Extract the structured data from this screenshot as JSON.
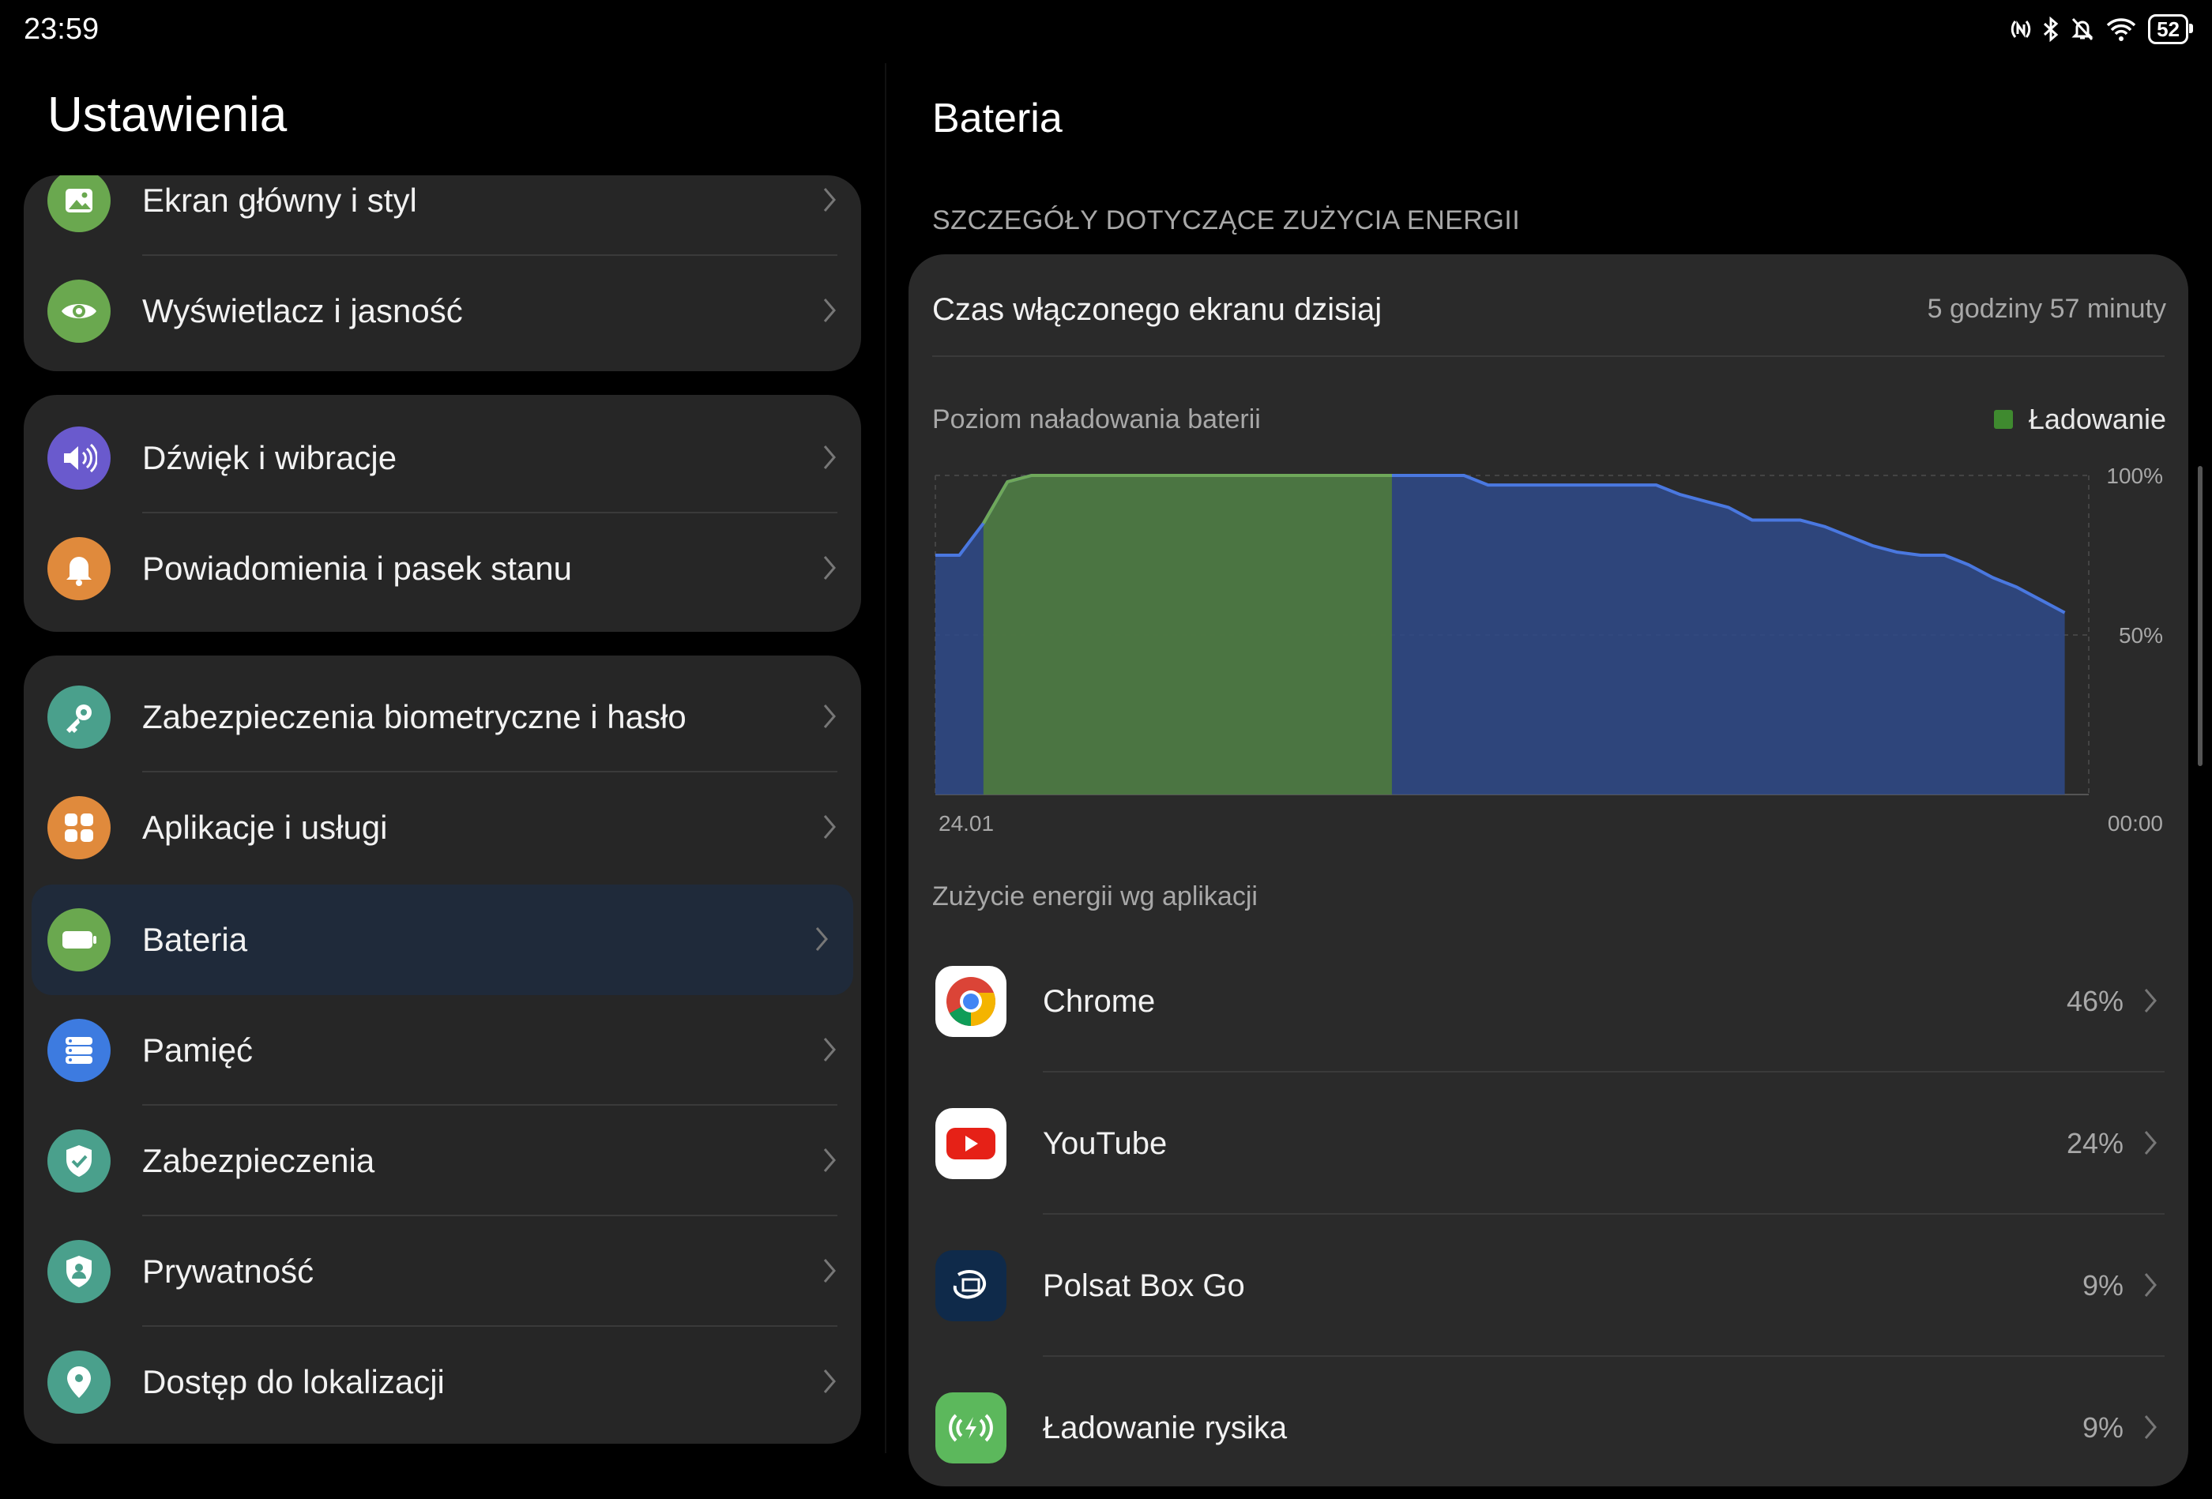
{
  "status_bar": {
    "time": "23:59",
    "battery": "52",
    "icons": [
      "nfc-icon",
      "bluetooth-icon",
      "mute-icon",
      "wifi-icon",
      "battery-icon"
    ]
  },
  "left": {
    "title": "Ustawienia",
    "groups": [
      {
        "items": [
          {
            "label": "Ekran główny i styl",
            "icon": "wallpaper-icon",
            "color": "#6aa84f"
          },
          {
            "label": "Wyświetlacz i jasność",
            "icon": "eye-icon",
            "color": "#6aa84f"
          }
        ]
      },
      {
        "items": [
          {
            "label": "Dźwięk i wibracje",
            "icon": "speaker-icon",
            "color": "#6a5acd"
          },
          {
            "label": "Powiadomienia i pasek stanu",
            "icon": "bell-icon",
            "color": "#e08a3c"
          }
        ]
      },
      {
        "items": [
          {
            "label": "Zabezpieczenia biometryczne i hasło",
            "icon": "key-icon",
            "color": "#4aa08c"
          },
          {
            "label": "Aplikacje i usługi",
            "icon": "apps-icon",
            "color": "#e08a3c"
          },
          {
            "label": "Bateria",
            "icon": "battery-icon",
            "color": "#6aa84f",
            "selected": true
          },
          {
            "label": "Pamięć",
            "icon": "storage-icon",
            "color": "#3d7be0"
          },
          {
            "label": "Zabezpieczenia",
            "icon": "shield-check-icon",
            "color": "#4aa08c"
          },
          {
            "label": "Prywatność",
            "icon": "privacy-icon",
            "color": "#4aa08c"
          },
          {
            "label": "Dostęp do lokalizacji",
            "icon": "location-icon",
            "color": "#4aa08c"
          }
        ]
      }
    ]
  },
  "right": {
    "title": "Bateria",
    "section_caption": "SZCZEGÓŁY DOTYCZĄCE ZUŻYCIA ENERGII",
    "screen_time_label": "Czas włączonego ekranu dzisiaj",
    "screen_time_value": "5 godziny 57 minuty",
    "chart_label": "Poziom naładowania baterii",
    "legend_label": "Ładowanie",
    "apps_caption": "Zużycie energii wg aplikacji",
    "apps": [
      {
        "name": "Chrome",
        "percent": "46%",
        "icon": "chrome-icon"
      },
      {
        "name": "YouTube",
        "percent": "24%",
        "icon": "youtube-icon"
      },
      {
        "name": "Polsat Box Go",
        "percent": "9%",
        "icon": "polsat-box-go-icon"
      },
      {
        "name": "Ładowanie rysika",
        "percent": "9%",
        "icon": "stylus-charging-icon"
      }
    ]
  },
  "chart_data": {
    "type": "area",
    "title": "Poziom naładowania baterii",
    "x_tick_labels": [
      "24.01",
      "00:00"
    ],
    "y_tick_labels": [
      "100%",
      "50%"
    ],
    "ylim": [
      0,
      100
    ],
    "xlim": [
      0,
      24
    ],
    "x_unit": "hours since 24.01 00:00",
    "legend": [
      "Ładowanie"
    ],
    "grid": true,
    "colors": {
      "line": "#4a78e0",
      "fill": "#2f4a8a",
      "charging": "#4f7a3c",
      "charging_line": "#6fa85a"
    },
    "charging_ranges": [
      [
        1.0,
        9.5
      ]
    ],
    "series": [
      {
        "name": "Bateria",
        "points": [
          [
            0.0,
            75
          ],
          [
            0.5,
            75
          ],
          [
            1.0,
            85
          ],
          [
            1.5,
            98
          ],
          [
            2.0,
            100
          ],
          [
            9.5,
            100
          ],
          [
            11.0,
            100
          ],
          [
            11.5,
            97
          ],
          [
            15.0,
            97
          ],
          [
            15.5,
            94
          ],
          [
            16.5,
            90
          ],
          [
            17.0,
            86
          ],
          [
            18.0,
            86
          ],
          [
            18.5,
            84
          ],
          [
            19.0,
            81
          ],
          [
            19.5,
            78
          ],
          [
            20.0,
            76
          ],
          [
            20.5,
            75
          ],
          [
            21.0,
            75
          ],
          [
            21.5,
            72
          ],
          [
            22.0,
            68
          ],
          [
            22.5,
            65
          ],
          [
            23.0,
            61
          ],
          [
            23.5,
            57
          ]
        ]
      }
    ]
  }
}
